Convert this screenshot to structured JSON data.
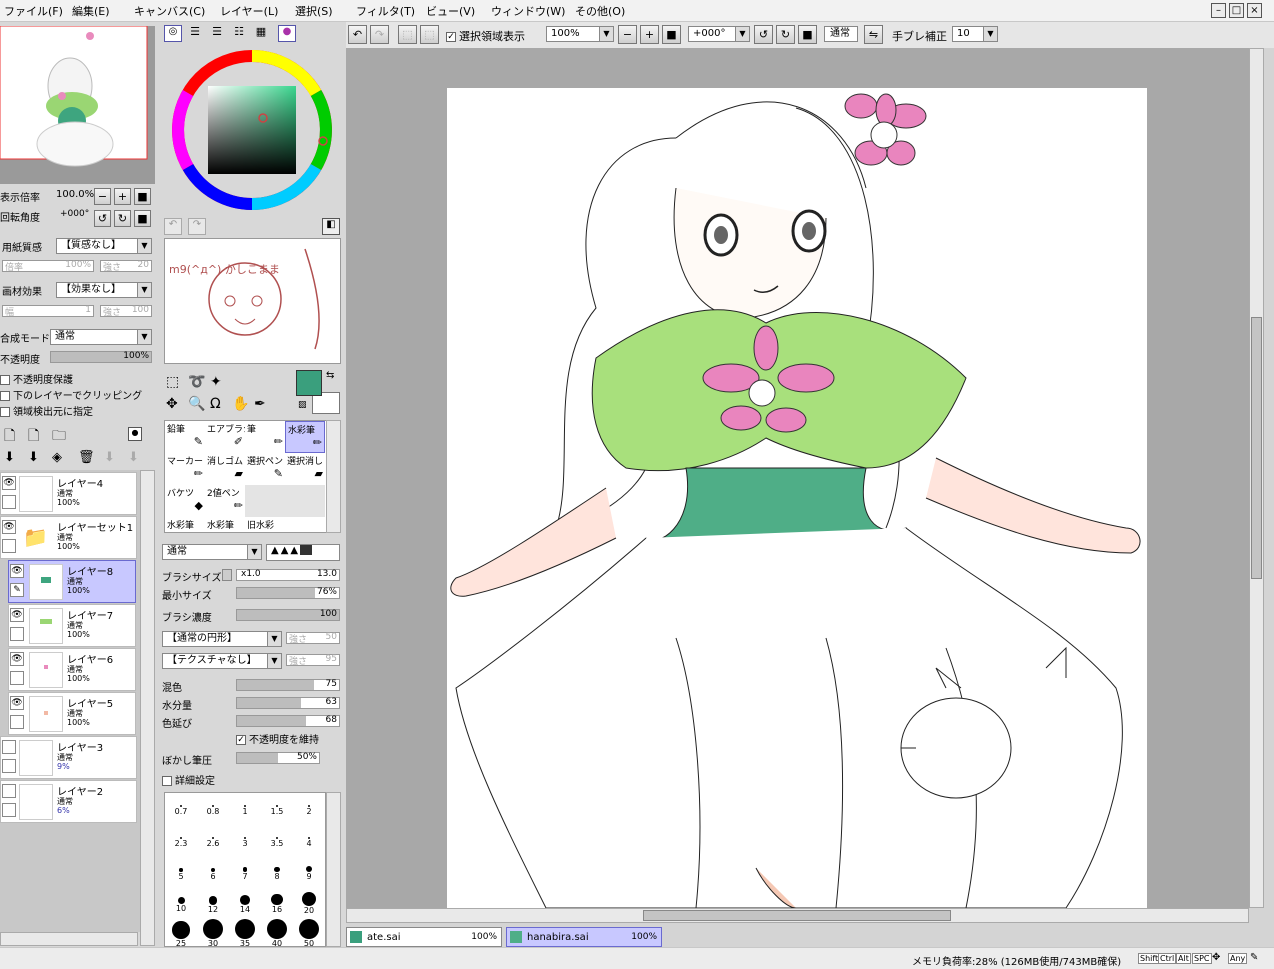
{
  "menu": [
    "ファイル(F)",
    "編集(E)",
    "キャンバス(C)",
    "レイヤー(L)",
    "選択(S)",
    "フィルタ(T)",
    "ビュー(V)",
    "ウィンドウ(W)",
    "その他(O)"
  ],
  "navigator": {
    "zoom_label": "表示倍率",
    "zoom": "100.0%",
    "rot_label": "回転角度",
    "rot": "+000°"
  },
  "paper": {
    "tex_label": "用紙質感",
    "tex_val": "【質感なし】",
    "scale": "倍率",
    "scale_v": "100%",
    "str": "強さ",
    "str_v": "20",
    "eff_label": "画材効果",
    "eff_val": "【効果なし】",
    "width": "幅",
    "width_v": "1",
    "str2": "強さ",
    "str2_v": "100"
  },
  "blend": {
    "mode_label": "合成モード",
    "mode": "通常",
    "opacity_label": "不透明度",
    "opacity": "100%",
    "protect": "不透明度保護",
    "clip": "下のレイヤーでクリッピング",
    "source": "領域検出元に指定"
  },
  "layers": [
    {
      "name": "レイヤー4",
      "mode": "通常",
      "op": "100%"
    },
    {
      "name": "レイヤーセット1",
      "mode": "通常",
      "op": "100%"
    },
    {
      "name": "レイヤー8",
      "mode": "通常",
      "op": "100%"
    },
    {
      "name": "レイヤー7",
      "mode": "通常",
      "op": "100%"
    },
    {
      "name": "レイヤー6",
      "mode": "通常",
      "op": "100%"
    },
    {
      "name": "レイヤー5",
      "mode": "通常",
      "op": "100%"
    },
    {
      "name": "レイヤー3",
      "mode": "通常",
      "op": "9%"
    },
    {
      "name": "レイヤー2",
      "mode": "通常",
      "op": "6%"
    }
  ],
  "scratch_text": "m9(^д^) かしこまま",
  "tools": [
    "鉛筆",
    "エアブラシ",
    "筆",
    "水彩筆",
    "マーカー",
    "消しゴム",
    "選択ペン",
    "選択消し",
    "バケツ",
    "2値ペン",
    "",
    "",
    "水彩筆",
    "水彩筆",
    "旧水彩",
    ""
  ],
  "brush": {
    "mode": "通常",
    "size_label": "ブラシサイズ",
    "size_mult": "x1.0",
    "size": "13.0",
    "min_label": "最小サイズ",
    "min": "76%",
    "density_label": "ブラシ濃度",
    "density": "100",
    "shape": "【通常の円形】",
    "shape_str": "強さ",
    "shape_str_v": "50",
    "texture": "【テクスチャなし】",
    "tex_str": "強さ",
    "tex_str_v": "95",
    "mix_label": "混色",
    "mix": "75",
    "water_label": "水分量",
    "water": "63",
    "ext_label": "色延び",
    "ext": "68",
    "keep": "不透明度を維持",
    "blur_label": "ぼかし筆圧",
    "blur": "50%",
    "detail": "詳細設定"
  },
  "sizes": [
    "0.7",
    "0.8",
    "1",
    "1.5",
    "2",
    "2.3",
    "2.6",
    "3",
    "3.5",
    "4",
    "5",
    "6",
    "7",
    "8",
    "9",
    "10",
    "12",
    "14",
    "16",
    "20",
    "25",
    "30",
    "35",
    "40",
    "50"
  ],
  "toolbar": {
    "sel_show": "選択領域表示",
    "zoom": "100%",
    "rot": "+000°",
    "mode": "通常",
    "stab_label": "手ブレ補正",
    "stab": "10"
  },
  "tabs": [
    {
      "name": "ate.sai",
      "zoom": "100%"
    },
    {
      "name": "hanabira.sai",
      "zoom": "100%"
    }
  ],
  "status": {
    "memory": "メモリ負荷率:28% (126MB使用/743MB確保)",
    "keys": [
      "Shift",
      "Ctrl",
      "Alt",
      "SPC",
      "Any"
    ]
  },
  "colors": {
    "fg": "#3a9f7d",
    "accent": "#c8c8ff"
  }
}
